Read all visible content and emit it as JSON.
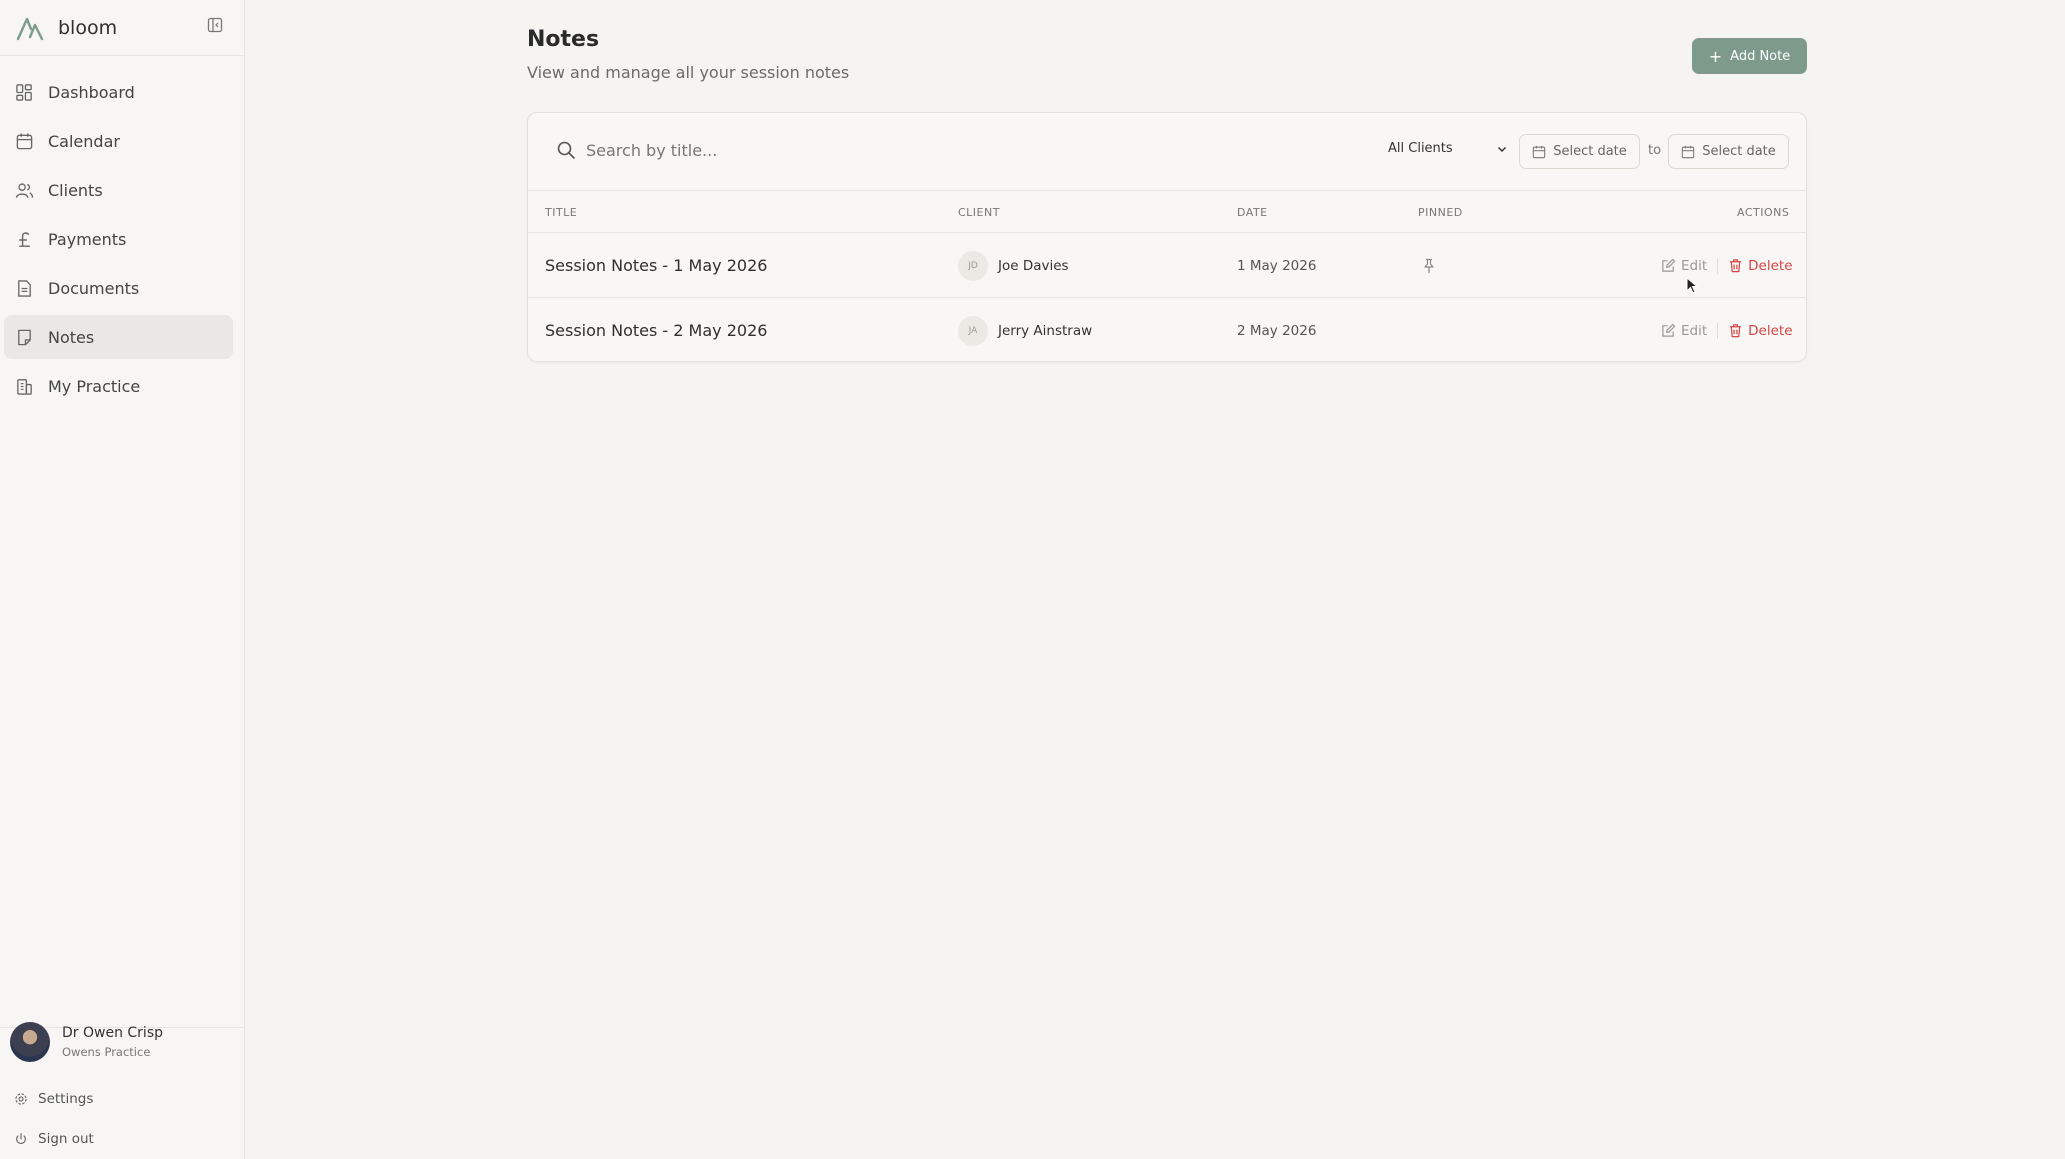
{
  "app": {
    "name": "bloom"
  },
  "nav": {
    "items": [
      {
        "label": "Dashboard",
        "icon": "dashboard-icon",
        "active": false
      },
      {
        "label": "Calendar",
        "icon": "calendar-icon",
        "active": false
      },
      {
        "label": "Clients",
        "icon": "clients-icon",
        "active": false
      },
      {
        "label": "Payments",
        "icon": "pound-icon",
        "active": false
      },
      {
        "label": "Documents",
        "icon": "document-icon",
        "active": false
      },
      {
        "label": "Notes",
        "icon": "note-icon",
        "active": true
      },
      {
        "label": "My Practice",
        "icon": "building-icon",
        "active": false
      }
    ]
  },
  "user": {
    "name": "Dr Owen Crisp",
    "practice": "Owens Practice"
  },
  "footer": {
    "settings": "Settings",
    "signout": "Sign out"
  },
  "page": {
    "title": "Notes",
    "subtitle": "View and manage all your session notes",
    "add_label": "Add Note"
  },
  "filters": {
    "search_placeholder": "Search by title...",
    "client_filter": "All Clients",
    "date_from": "Select date",
    "to_label": "to",
    "date_to": "Select date"
  },
  "table": {
    "headers": {
      "title": "TITLE",
      "client": "CLIENT",
      "date": "DATE",
      "pinned": "PINNED",
      "actions": "ACTIONS"
    },
    "rows": [
      {
        "title": "Session Notes - 1 May 2026",
        "initials": "JD",
        "client": "Joe Davies",
        "date": "1 May 2026",
        "pinned": true,
        "edit": "Edit",
        "delete": "Delete"
      },
      {
        "title": "Session Notes - 2 May 2026",
        "initials": "JA",
        "client": "Jerry Ainstraw",
        "date": "2 May 2026",
        "pinned": false,
        "edit": "Edit",
        "delete": "Delete"
      }
    ]
  },
  "colors": {
    "accent": "#7e9a8b",
    "danger": "#d64545",
    "active_nav": "#e9e8e4"
  }
}
